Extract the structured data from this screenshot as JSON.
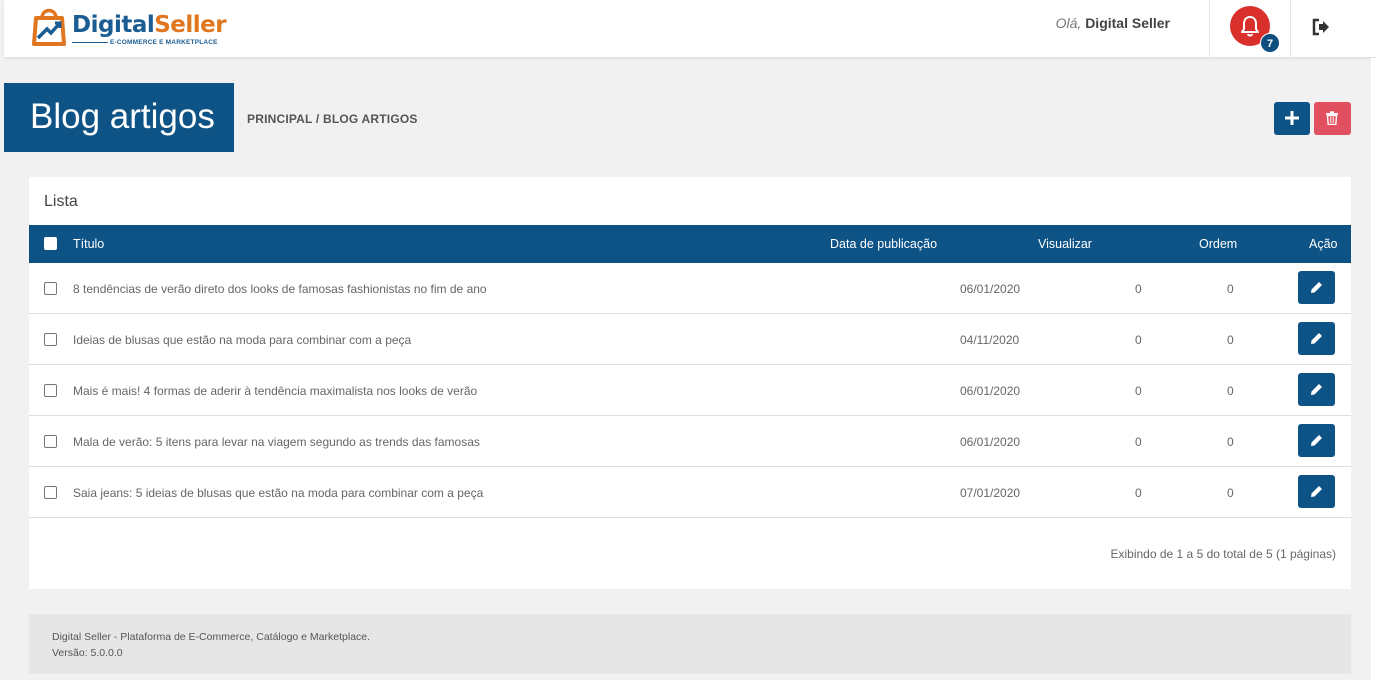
{
  "header": {
    "logo_main_1": "Digital",
    "logo_main_2": "Seller",
    "logo_sub": "E-COMMERCE E MARKETPLACE",
    "greeting_prefix": "Olá,",
    "user_name": "Digital Seller",
    "notification_count": "7",
    "bell_color": "#d9302b"
  },
  "page": {
    "title": "Blog artigos",
    "breadcrumb": "PRINCIPAL / BLOG ARTIGOS",
    "accent": "#0e5386",
    "danger": "#e0505e"
  },
  "list": {
    "title": "Lista",
    "columns": {
      "title": "Título",
      "date": "Data de publicação",
      "views": "Visualizar",
      "order": "Ordem",
      "action": "Ação"
    },
    "rows": [
      {
        "title": "8 tendências de verão direto dos looks de famosas fashionistas no fim de ano",
        "date": "06/01/2020",
        "views": "0",
        "order": "0"
      },
      {
        "title": "Ideias de blusas que estão na moda para combinar com a peça",
        "date": "04/11/2020",
        "views": "0",
        "order": "0"
      },
      {
        "title": "Mais é mais! 4 formas de aderir à tendência maximalista nos looks de verão",
        "date": "06/01/2020",
        "views": "0",
        "order": "0"
      },
      {
        "title": "Mala de verão: 5 itens para levar na viagem segundo as trends das famosas",
        "date": "06/01/2020",
        "views": "0",
        "order": "0"
      },
      {
        "title": "Saia jeans: 5 ideias de blusas que estão na moda para combinar com a peça",
        "date": "07/01/2020",
        "views": "0",
        "order": "0"
      }
    ],
    "pagination_info": "Exibindo de 1 a 5 do total de 5 (1 páginas)"
  },
  "footer": {
    "line1": "Digital Seller - Plataforma de E-Commerce, Catálogo e Marketplace.",
    "line2": "Versão: 5.0.0.0"
  },
  "icons": {
    "bell": "bell-icon",
    "logout": "sign-out-icon",
    "add": "plus-icon",
    "delete": "trash-icon",
    "edit": "pencil-icon"
  }
}
